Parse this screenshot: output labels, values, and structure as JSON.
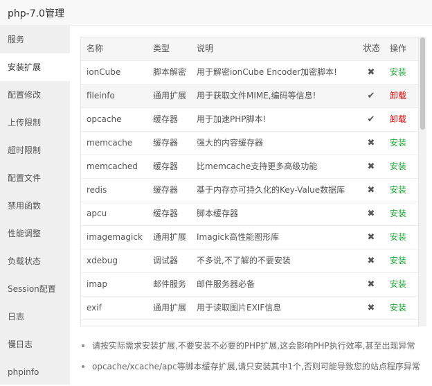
{
  "window": {
    "title": "php-7.0管理"
  },
  "sidebar": {
    "items": [
      {
        "label": "服务"
      },
      {
        "label": "安装扩展"
      },
      {
        "label": "配置修改"
      },
      {
        "label": "上传限制"
      },
      {
        "label": "超时限制"
      },
      {
        "label": "配置文件"
      },
      {
        "label": "禁用函数"
      },
      {
        "label": "性能调整"
      },
      {
        "label": "负载状态"
      },
      {
        "label": "Session配置"
      },
      {
        "label": "日志"
      },
      {
        "label": "慢日志"
      },
      {
        "label": "phpinfo"
      }
    ],
    "active_index": 1
  },
  "table": {
    "headers": {
      "name": "名称",
      "type": "类型",
      "desc": "说明",
      "status": "状态",
      "op": "操作"
    },
    "rows": [
      {
        "name": "ionCube",
        "type": "脚本解密",
        "desc": "用于解密ionCube Encoder加密脚本!",
        "status": "✖",
        "op": "安装"
      },
      {
        "name": "fileinfo",
        "type": "通用扩展",
        "desc": "用于获取文件MIME,编码等信息!",
        "status": "✔",
        "op": "卸载"
      },
      {
        "name": "opcache",
        "type": "缓存器",
        "desc": "用于加速PHP脚本!",
        "status": "✔",
        "op": "卸载"
      },
      {
        "name": "memcache",
        "type": "缓存器",
        "desc": "强大的内容缓存器",
        "status": "✖",
        "op": "安装"
      },
      {
        "name": "memcached",
        "type": "缓存器",
        "desc": "比memcache支持更多高级功能",
        "status": "✖",
        "op": "安装"
      },
      {
        "name": "redis",
        "type": "缓存器",
        "desc": "基于内存亦可持久化的Key-Value数据库",
        "status": "✖",
        "op": "安装"
      },
      {
        "name": "apcu",
        "type": "缓存器",
        "desc": "脚本缓存器",
        "status": "✖",
        "op": "安装"
      },
      {
        "name": "imagemagick",
        "type": "通用扩展",
        "desc": "Imagick高性能图形库",
        "status": "✖",
        "op": "安装"
      },
      {
        "name": "xdebug",
        "type": "调试器",
        "desc": "不多说,不了解的不要安装",
        "status": "✖",
        "op": "安装"
      },
      {
        "name": "imap",
        "type": "邮件服务",
        "desc": "邮件服务器必备",
        "status": "✖",
        "op": "安装"
      },
      {
        "name": "exif",
        "type": "通用扩展",
        "desc": "用于读取图片EXIF信息",
        "status": "✖",
        "op": "安装"
      }
    ]
  },
  "notes": [
    "请按实际需求安装扩展,不要安装不必要的PHP扩展,这会影响PHP执行效率,甚至出现异常",
    "opcache/xcache/apc等脚本缓存扩展,请只安装其中1个,否则可能导致您的站点程序异常"
  ],
  "colors": {
    "install": "#20a53a",
    "uninstall": "#d00000",
    "sidebar_bg": "#f0f0f0"
  }
}
